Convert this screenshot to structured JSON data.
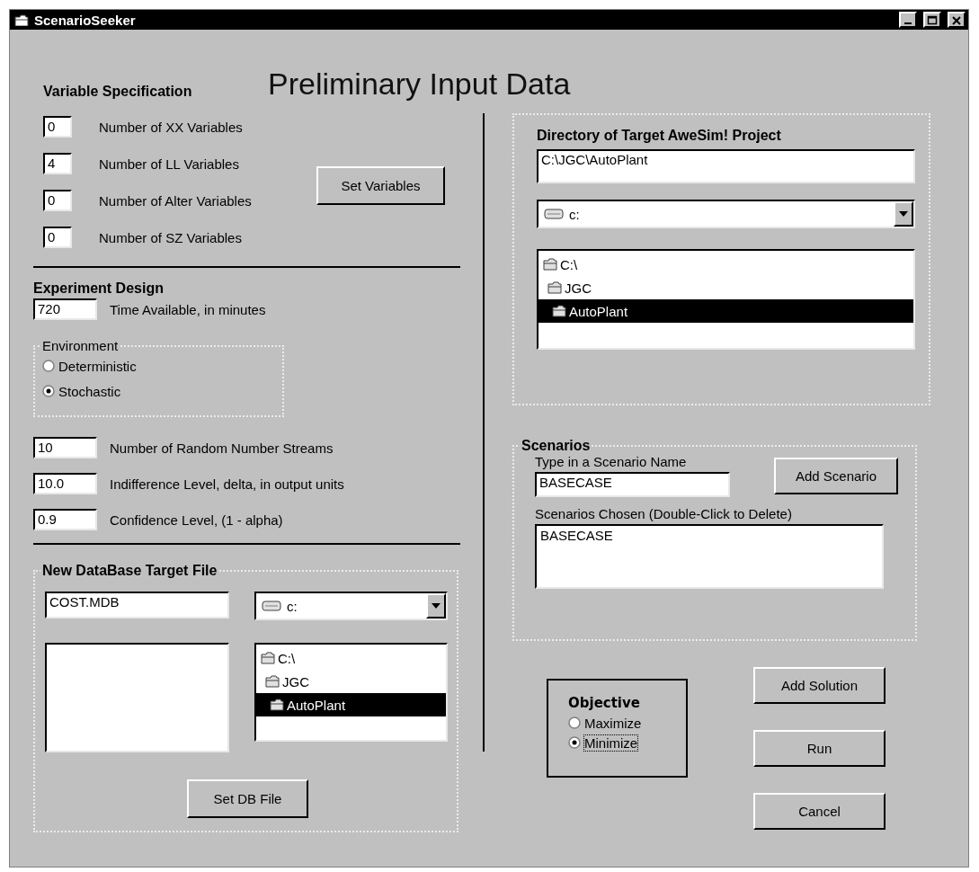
{
  "window": {
    "title": "ScenarioSeeker"
  },
  "heading": "Preliminary Input Data",
  "variable_specification": {
    "title": "Variable Specification",
    "rows": [
      {
        "value": "0",
        "label": "Number of XX Variables"
      },
      {
        "value": "4",
        "label": "Number of LL Variables"
      },
      {
        "value": "0",
        "label": "Number of Alter Variables"
      },
      {
        "value": "0",
        "label": "Number of SZ Variables"
      }
    ],
    "button": "Set Variables"
  },
  "experiment_design": {
    "title": "Experiment Design",
    "time": {
      "value": "720",
      "label": "Time Available, in minutes"
    },
    "environment": {
      "title": "Environment",
      "options": [
        {
          "label": "Deterministic",
          "selected": false
        },
        {
          "label": "Stochastic",
          "selected": true
        }
      ]
    },
    "rows": [
      {
        "value": "10",
        "label": "Number of Random Number Streams"
      },
      {
        "value": "10.0",
        "label": "Indifference Level, delta, in output units"
      },
      {
        "value": "0.9",
        "label": "Confidence Level, (1 - alpha)"
      }
    ]
  },
  "database_file": {
    "title": "New DataBase Target File",
    "file_name": "COST.MDB",
    "drive": "c:",
    "folders": [
      {
        "label": "C:\\",
        "selected": false,
        "children": [
          {
            "label": "JGC",
            "selected": false,
            "children": [
              {
                "label": "AutoPlant",
                "selected": true
              }
            ]
          }
        ]
      }
    ],
    "button": "Set DB File"
  },
  "project_directory": {
    "title": "Directory of Target AweSim! Project",
    "path": "C:\\JGC\\AutoPlant",
    "drive": "c:",
    "folders": [
      {
        "label": "C:\\",
        "selected": false,
        "children": [
          {
            "label": "JGC",
            "selected": false,
            "children": [
              {
                "label": "AutoPlant",
                "selected": true
              }
            ]
          }
        ]
      }
    ]
  },
  "scenarios": {
    "title": "Scenarios",
    "name_label": "Type in a Scenario Name",
    "name_value": "BASECASE",
    "add_button": "Add Scenario",
    "chosen_label": "Scenarios Chosen (Double-Click to Delete)",
    "chosen": [
      "BASECASE"
    ]
  },
  "objective": {
    "title": "Objective",
    "options": [
      {
        "label": "Maximize",
        "selected": false
      },
      {
        "label": "Minimize",
        "selected": true
      }
    ]
  },
  "buttons": [
    "Add Solution",
    "Run",
    "Cancel"
  ]
}
